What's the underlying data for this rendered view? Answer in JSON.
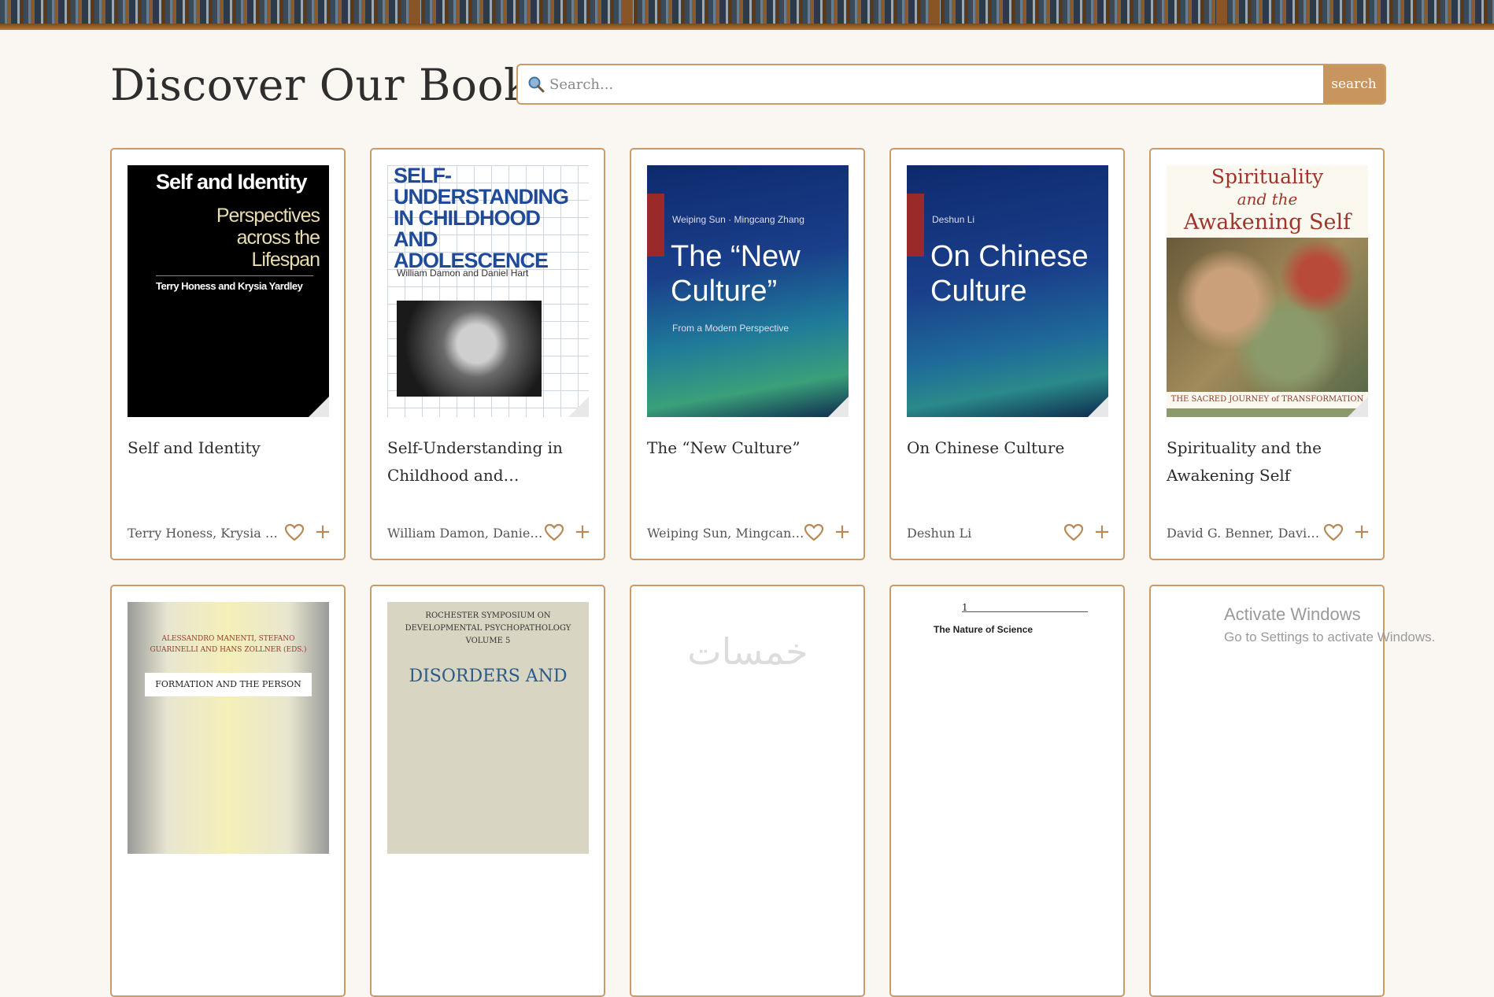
{
  "page": {
    "title": "Discover Our Books",
    "search_placeholder": "Search...",
    "search_button": "search"
  },
  "books": [
    {
      "title": "Self and Identity",
      "author": "Terry Honess, Krysia M. Yardley",
      "cover": {
        "title": "Self and Identity",
        "subtitle": "Perspectives across the Lifespan",
        "editors": "Terry Honess and Krysia Yardley"
      }
    },
    {
      "title": "Self-Understanding in Childhood and…",
      "author": "William Damon, Daniel Hart",
      "cover": {
        "title": "SELF-UNDERSTANDING IN CHILDHOOD AND ADOLESCENCE",
        "authors": "William Damon and Daniel Hart"
      }
    },
    {
      "title": "The “New Culture”",
      "author": "Weiping Sun, Mingcang Zhang",
      "cover": {
        "authors": "Weiping Sun · Mingcang Zhang",
        "title": "The “New Culture”",
        "subtitle": "From a Modern Perspective"
      }
    },
    {
      "title": "On Chinese Culture",
      "author": "Deshun Li",
      "cover": {
        "authors": "Deshun Li",
        "title": "On Chinese Culture"
      }
    },
    {
      "title": "Spirituality and the Awakening Self",
      "author": "David G. Benner, David G. Benner",
      "cover": {
        "line1": "Spirituality",
        "line2": "and the",
        "line3": "Awakening Self",
        "subtitle": "THE SACRED JOURNEY of TRANSFORMATION"
      }
    }
  ],
  "second_row": [
    {
      "cover": {
        "authors": "ALESSANDRO MANENTI, STEFANO GUARINELLI AND HANS ZOLLNER (EDS.)",
        "title": "FORMATION AND THE PERSON"
      }
    },
    {
      "cover": {
        "series": "ROCHESTER SYMPOSIUM ON DEVELOPMENTAL PSYCHOPATHOLOGY",
        "volume": "VOLUME 5",
        "title": "DISORDERS AND"
      }
    },
    {
      "cover": {
        "placeholder": "خمسات"
      }
    },
    {
      "cover": {
        "chapter": "1",
        "title": "The Nature of Science"
      }
    },
    {
      "cover": {}
    }
  ],
  "watermark": {
    "line1": "Activate Windows",
    "line2": "Go to Settings to activate Windows."
  },
  "colors": {
    "accent": "#c9955f",
    "border": "#c99a6a",
    "background": "#faf7f2"
  }
}
